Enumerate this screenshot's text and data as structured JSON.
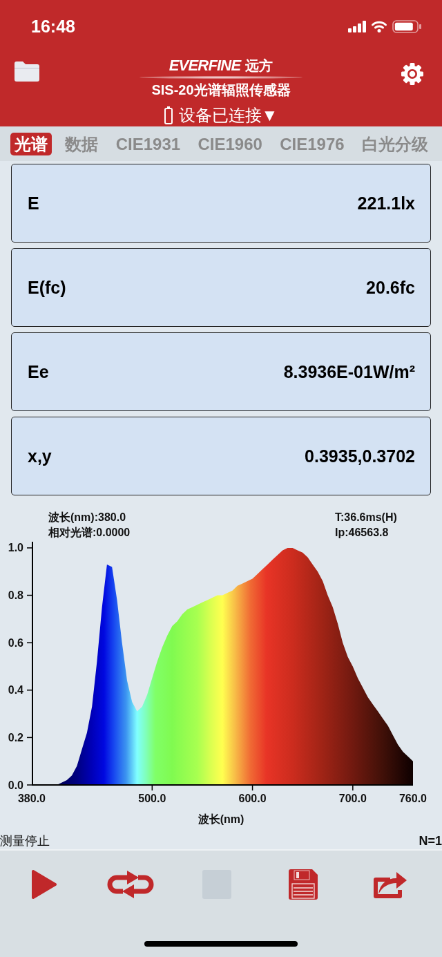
{
  "status_bar": {
    "time": "16:48"
  },
  "header": {
    "logo_name": "EVERFINE",
    "logo_name_cn": "远方",
    "subtitle": "SIS-20光谱辐照传感器",
    "device_status": "设备已连接▼"
  },
  "tabs": [
    {
      "label": "光谱",
      "selected": true
    },
    {
      "label": "数据",
      "selected": false
    },
    {
      "label": "CIE1931",
      "selected": false
    },
    {
      "label": "CIE1960",
      "selected": false
    },
    {
      "label": "CIE1976",
      "selected": false
    },
    {
      "label": "白光分级",
      "selected": false
    }
  ],
  "measurements": [
    {
      "label": "E",
      "value": "221.1lx"
    },
    {
      "label": "E(fc)",
      "value": "20.6fc"
    },
    {
      "label": "Ee",
      "value": "8.3936E-01W/m²"
    },
    {
      "label": "x,y",
      "value": "0.3935,0.3702"
    }
  ],
  "spectrum": {
    "wavelength_readout": "波长(nm):380.0",
    "intensity_readout": "相对光谱:0.0000",
    "integration_time": "T:36.6ms(H)",
    "peak_count": "Ip:46563.8",
    "chart_data": {
      "type": "area",
      "xlabel": "波长(nm)",
      "x": [
        380,
        385,
        390,
        395,
        400,
        405,
        410,
        415,
        420,
        425,
        430,
        435,
        440,
        445,
        450,
        455,
        460,
        465,
        470,
        475,
        480,
        485,
        490,
        495,
        500,
        505,
        510,
        515,
        520,
        525,
        530,
        535,
        540,
        545,
        550,
        555,
        560,
        565,
        570,
        575,
        580,
        585,
        590,
        595,
        600,
        605,
        610,
        615,
        620,
        625,
        630,
        635,
        640,
        645,
        650,
        655,
        660,
        665,
        670,
        675,
        680,
        685,
        690,
        695,
        700,
        705,
        710,
        715,
        720,
        725,
        730,
        735,
        740,
        745,
        750,
        755,
        760
      ],
      "values": [
        0,
        0,
        0,
        0,
        0,
        0,
        0.01,
        0.02,
        0.04,
        0.08,
        0.15,
        0.22,
        0.33,
        0.52,
        0.75,
        0.93,
        0.92,
        0.78,
        0.6,
        0.44,
        0.35,
        0.31,
        0.33,
        0.38,
        0.45,
        0.52,
        0.58,
        0.63,
        0.67,
        0.69,
        0.72,
        0.74,
        0.75,
        0.76,
        0.77,
        0.78,
        0.79,
        0.8,
        0.8,
        0.81,
        0.82,
        0.84,
        0.85,
        0.86,
        0.87,
        0.89,
        0.91,
        0.93,
        0.95,
        0.97,
        0.99,
        1.0,
        1.0,
        0.99,
        0.98,
        0.96,
        0.93,
        0.9,
        0.86,
        0.8,
        0.75,
        0.68,
        0.6,
        0.54,
        0.5,
        0.45,
        0.41,
        0.37,
        0.34,
        0.31,
        0.28,
        0.25,
        0.21,
        0.17,
        0.14,
        0.12,
        0.1
      ],
      "xlim": [
        380,
        760
      ],
      "ylim": [
        0,
        1.026
      ],
      "xticks": [
        {
          "value": 380,
          "label": "380.0"
        },
        {
          "value": 500,
          "label": "500.0"
        },
        {
          "value": 600,
          "label": "600.0"
        },
        {
          "value": 700,
          "label": "700.0"
        },
        {
          "value": 760,
          "label": "760.0"
        }
      ],
      "yticks": [
        {
          "value": 0,
          "label": "0.0"
        },
        {
          "value": 0.2,
          "label": "0.2"
        },
        {
          "value": 0.4,
          "label": "0.4"
        },
        {
          "value": 0.6,
          "label": "0.6"
        },
        {
          "value": 0.8,
          "label": "0.8"
        },
        {
          "value": 1,
          "label": "1.0"
        }
      ]
    }
  },
  "status": {
    "state": "测量停止",
    "count": "N=1"
  },
  "toolbar": [
    {
      "kind": "play",
      "disabled": false
    },
    {
      "kind": "loop",
      "disabled": false
    },
    {
      "kind": "stop",
      "disabled": true
    },
    {
      "kind": "save",
      "disabled": false
    },
    {
      "kind": "share",
      "disabled": false
    }
  ]
}
